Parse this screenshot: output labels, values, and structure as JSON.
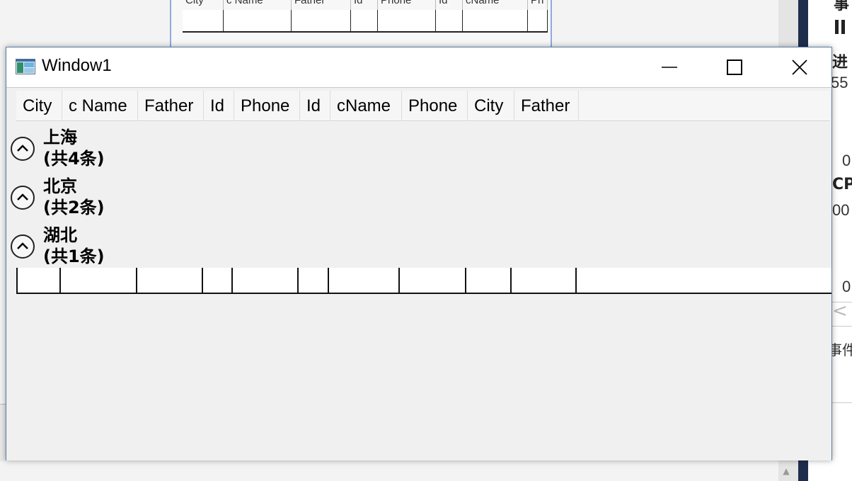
{
  "window": {
    "title": "Window1",
    "controls": {
      "minimize": "minimize-icon",
      "maximize": "maximize-icon",
      "close": "close-icon"
    }
  },
  "grid": {
    "columns": [
      "City",
      "c Name",
      "Father",
      "Id",
      "Phone",
      "Id",
      "cName",
      "Phone",
      "City",
      "Father"
    ],
    "groups": [
      {
        "name": "上海",
        "count": "(共4条)"
      },
      {
        "name": "北京",
        "count": "(共2条)"
      },
      {
        "name": "湖北",
        "count": "(共1条)"
      }
    ]
  },
  "background": {
    "header_columns": [
      "City",
      "c Name",
      "Father",
      "Id",
      "Phone",
      "Id",
      "cName",
      "Ph"
    ],
    "side_texts": [
      "事",
      "进",
      "55",
      "0",
      "CP",
      "00",
      "0",
      "事件"
    ]
  },
  "colors": {
    "window_border": "#5b7fa8",
    "content_bg": "#f0f0f0",
    "ide_divider": "#1f2d4d"
  }
}
